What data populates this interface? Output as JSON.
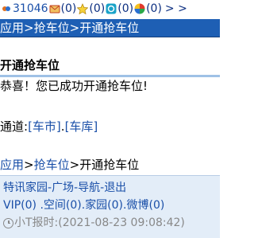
{
  "status": {
    "user_id": "31046",
    "counts": [
      "(0)",
      "(0)",
      "(0)",
      "(0)"
    ],
    "arrow": "> >"
  },
  "breadcrumb": {
    "app": "应用",
    "sep": ">",
    "section": "抢车位",
    "current": "开通抢车位"
  },
  "page": {
    "title": "开通抢车位",
    "message": "恭喜！您已成功开通抢车位!",
    "channel_prefix": "通道:",
    "channel_links": [
      "[车市]",
      "[车库]"
    ],
    "channel_sep": "."
  },
  "footer": {
    "links1": [
      "特讯家园",
      "广场",
      "导航",
      "退出"
    ],
    "sep1": "-",
    "vip": "VIP(0)",
    "links2": [
      "空间(0)",
      "家园(0)",
      "微博(0)"
    ],
    "sep2": ".",
    "time_label": "小T报时:",
    "time_value": "(2021-08-23 09:08:42)"
  },
  "colors": {
    "header_bg": "#1e5fb4",
    "link": "#1a4fa8",
    "footer_bg": "#e3edf8"
  }
}
